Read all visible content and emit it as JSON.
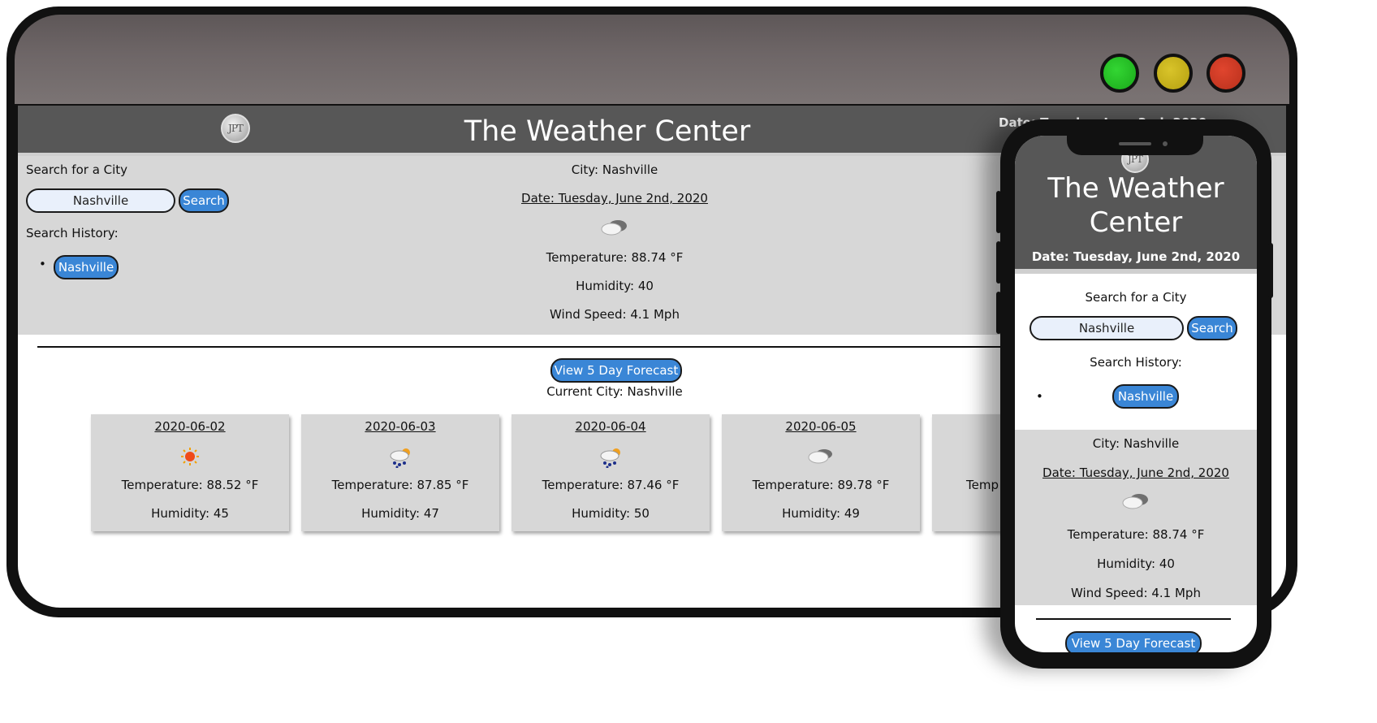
{
  "app": {
    "logo_text": "JPT",
    "title": "The Weather Center",
    "header_date": "Date: Tuesday, June 2nd, 2020"
  },
  "search": {
    "label": "Search for a City",
    "value": "Nashville",
    "button": "Search",
    "history_label": "Search History:",
    "history": [
      "Nashville"
    ]
  },
  "current": {
    "city": "City: Nashville",
    "date": "Date: Tuesday, June 2nd, 2020",
    "icon": "cloudy-icon",
    "temperature": "Temperature: 88.74 °F",
    "humidity": "Humidity: 40",
    "wind": "Wind Speed: 4.1 Mph"
  },
  "forecast": {
    "button": "View 5 Day Forecast",
    "current_city": "Current City: Nashville",
    "days": [
      {
        "date": "2020-06-02",
        "icon": "sunny-icon",
        "temperature": "Temperature: 88.52 °F",
        "humidity": "Humidity: 45"
      },
      {
        "date": "2020-06-03",
        "icon": "rain-icon",
        "temperature": "Temperature: 87.85 °F",
        "humidity": "Humidity: 47"
      },
      {
        "date": "2020-06-04",
        "icon": "rain-icon",
        "temperature": "Temperature: 87.46 °F",
        "humidity": "Humidity: 50"
      },
      {
        "date": "2020-06-05",
        "icon": "cloudy-icon",
        "temperature": "Temperature: 89.78 °F",
        "humidity": "Humidity: 49"
      },
      {
        "date": "",
        "icon": "",
        "temperature": "Temp",
        "humidity": "H"
      }
    ]
  },
  "colors": {
    "header": "#575757",
    "panel": "#d7d7d7",
    "button": "#3a86d6",
    "input": "#e9f0fb"
  }
}
